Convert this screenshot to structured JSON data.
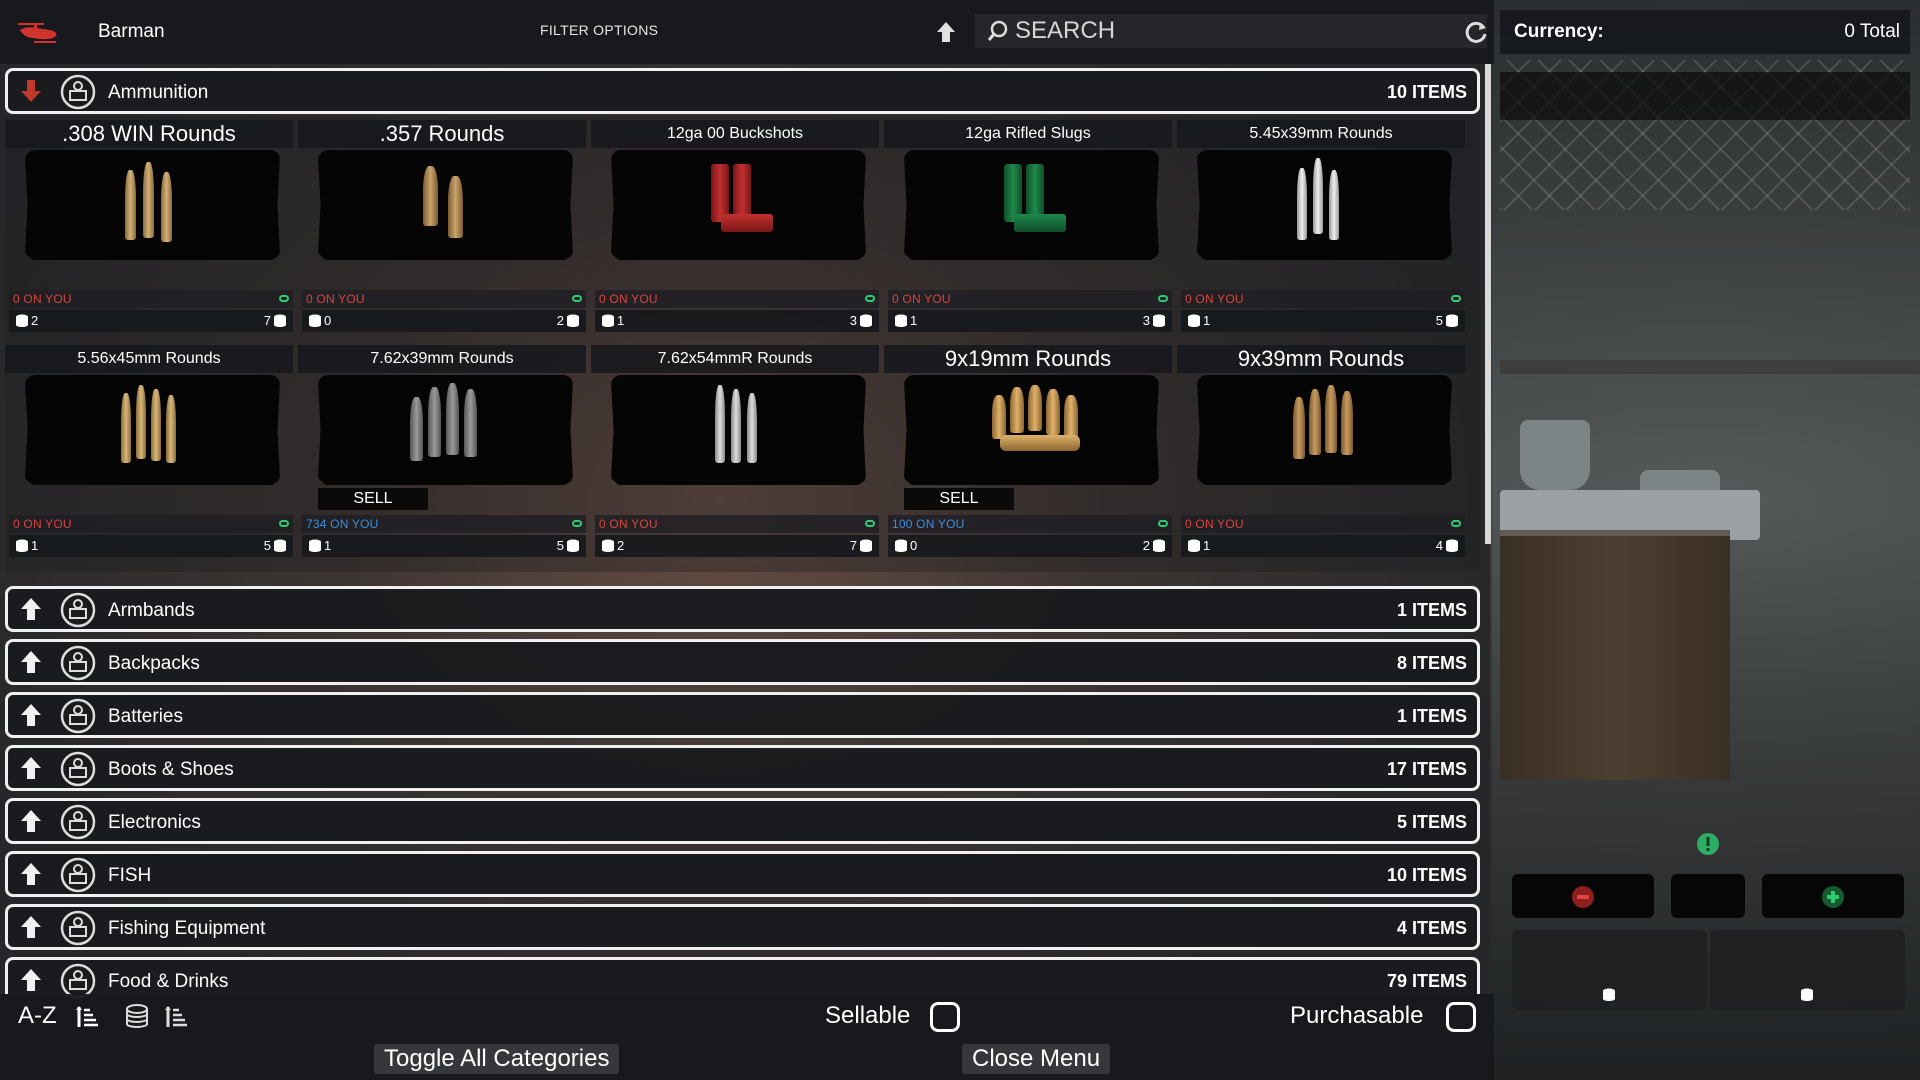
{
  "topbar": {
    "trader_name": "Barman",
    "filter_options": "FILTER OPTIONS",
    "search_placeholder": "SEARCH"
  },
  "currency": {
    "label": "Currency:",
    "total": "0 Total"
  },
  "expanded_category": {
    "name": "Ammunition",
    "count": "10 ITEMS",
    "items": [
      {
        "name": ".308 WIN Rounds",
        "owned": "0 ON YOU",
        "sell": "2",
        "buy": "7",
        "sell_tag": ""
      },
      {
        "name": ".357 Rounds",
        "owned": "0 ON YOU",
        "sell": "0",
        "buy": "2",
        "sell_tag": ""
      },
      {
        "name": "12ga 00 Buckshots",
        "owned": "0 ON YOU",
        "sell": "1",
        "buy": "3",
        "sell_tag": ""
      },
      {
        "name": "12ga Rifled Slugs",
        "owned": "0 ON YOU",
        "sell": "1",
        "buy": "3",
        "sell_tag": ""
      },
      {
        "name": "5.45x39mm Rounds",
        "owned": "0 ON YOU",
        "sell": "1",
        "buy": "5",
        "sell_tag": ""
      },
      {
        "name": "5.56x45mm Rounds",
        "owned": "0 ON YOU",
        "sell": "1",
        "buy": "5",
        "sell_tag": ""
      },
      {
        "name": "7.62x39mm Rounds",
        "owned": "734 ON YOU",
        "sell": "1",
        "buy": "5",
        "sell_tag": "SELL"
      },
      {
        "name": "7.62x54mmR Rounds",
        "owned": "0 ON YOU",
        "sell": "2",
        "buy": "7",
        "sell_tag": ""
      },
      {
        "name": "9x19mm Rounds",
        "owned": "100 ON YOU",
        "sell": "0",
        "buy": "2",
        "sell_tag": "SELL"
      },
      {
        "name": "9x39mm Rounds",
        "owned": "0 ON YOU",
        "sell": "1",
        "buy": "4",
        "sell_tag": ""
      }
    ]
  },
  "categories": [
    {
      "name": "Armbands",
      "count": "1 ITEMS"
    },
    {
      "name": "Backpacks",
      "count": "8 ITEMS"
    },
    {
      "name": "Batteries",
      "count": "1 ITEMS"
    },
    {
      "name": "Boots & Shoes",
      "count": "17 ITEMS"
    },
    {
      "name": "Electronics",
      "count": "5 ITEMS"
    },
    {
      "name": "FISH",
      "count": "10 ITEMS"
    },
    {
      "name": "Fishing Equipment",
      "count": "4 ITEMS"
    },
    {
      "name": "Food & Drinks",
      "count": "79 ITEMS"
    }
  ],
  "bottom": {
    "sort_az": "A-Z",
    "sellable": "Sellable",
    "purchasable": "Purchasable",
    "toggle_all": "Toggle All Categories",
    "close_menu": "Close Menu"
  },
  "colors": {
    "owned_zero": "#d8453c",
    "owned_positive": "#3b8fde",
    "expanded_arrow": "#c0392b",
    "minus": "#c0392b",
    "plus": "#27ae60",
    "warning": "#2ecc71"
  },
  "icons": {
    "trader": "helicopter-icon",
    "search": "search-icon",
    "refresh": "refresh-icon",
    "category": "trader-category-icon",
    "coin": "coin-stack-icon"
  }
}
